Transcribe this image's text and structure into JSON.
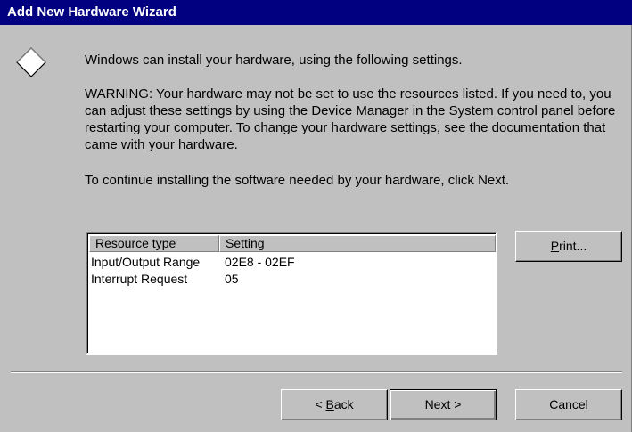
{
  "window": {
    "title": "Add New Hardware Wizard"
  },
  "messages": {
    "intro": "Windows can install your hardware, using the following settings.",
    "warning": "WARNING:  Your hardware may not be set to use the resources listed. If you need to, you can adjust these settings by using the Device Manager in the System control panel before restarting your computer. To change your hardware settings, see the documentation that came with your hardware.",
    "continue": "To continue installing the software needed by your hardware, click Next."
  },
  "resources": {
    "columns": [
      "Resource type",
      "Setting"
    ],
    "rows": [
      {
        "type": "Input/Output Range",
        "setting": "02E8 - 02EF"
      },
      {
        "type": "Interrupt Request",
        "setting": "05"
      }
    ]
  },
  "buttons": {
    "print": {
      "mnemonic": "P",
      "rest": "rint..."
    },
    "back": {
      "prefix": "< ",
      "mnemonic": "B",
      "rest": "ack"
    },
    "next": "Next >",
    "cancel": "Cancel"
  },
  "icons": {
    "wizard": "diamond-icon"
  },
  "colors": {
    "titlebar": "#000080",
    "face": "#c0c0c0"
  }
}
